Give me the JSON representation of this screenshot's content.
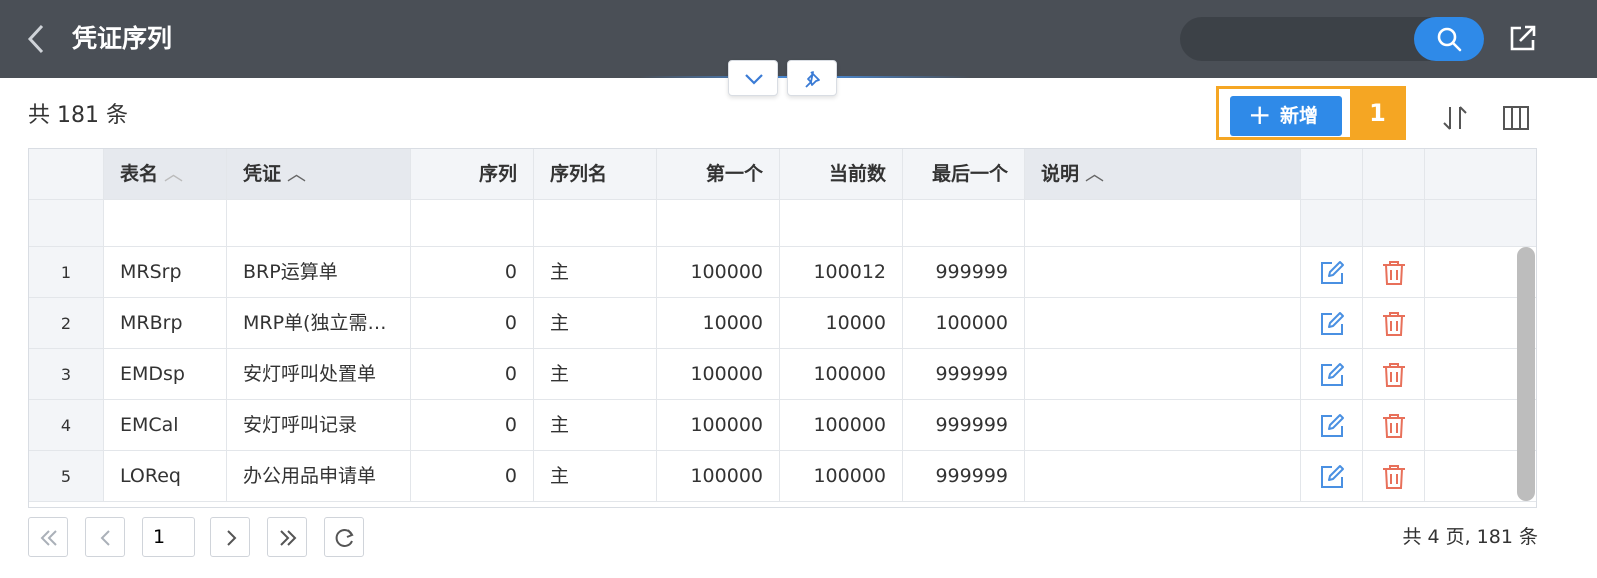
{
  "header": {
    "title": "凭证序列",
    "search_placeholder": ""
  },
  "toolbar": {
    "count_text": "共 181 条",
    "add_label": "新增",
    "badge": "1"
  },
  "table": {
    "columns": [
      "表名",
      "凭证",
      "序列",
      "序列名",
      "第一个",
      "当前数",
      "最后一个",
      "说明"
    ],
    "rows": [
      {
        "index": "1",
        "table_name": "MRSrp",
        "voucher": "BRP运算单",
        "seq": "0",
        "seq_name": "主",
        "first": "100000",
        "current": "100012",
        "last": "999999",
        "desc": ""
      },
      {
        "index": "2",
        "table_name": "MRBrp",
        "voucher": "MRP单(独立需…",
        "seq": "0",
        "seq_name": "主",
        "first": "10000",
        "current": "10000",
        "last": "100000",
        "desc": ""
      },
      {
        "index": "3",
        "table_name": "EMDsp",
        "voucher": "安灯呼叫处置单",
        "seq": "0",
        "seq_name": "主",
        "first": "100000",
        "current": "100000",
        "last": "999999",
        "desc": ""
      },
      {
        "index": "4",
        "table_name": "EMCal",
        "voucher": "安灯呼叫记录",
        "seq": "0",
        "seq_name": "主",
        "first": "100000",
        "current": "100000",
        "last": "999999",
        "desc": ""
      },
      {
        "index": "5",
        "table_name": "LOReq",
        "voucher": "办公用品申请单",
        "seq": "0",
        "seq_name": "主",
        "first": "100000",
        "current": "100000",
        "last": "999999",
        "desc": ""
      }
    ]
  },
  "pagination": {
    "current_page": "1",
    "summary": "共 4 页, 181 条"
  },
  "colors": {
    "topbar": "#4a4f56",
    "primary": "#2f8ae8",
    "highlight": "#f5a623",
    "edit_icon": "#4a90e2",
    "delete_icon": "#e8705a"
  },
  "icons": [
    "back-arrow-icon",
    "search-icon",
    "export-icon",
    "chevron-down-icon",
    "pin-icon",
    "plus-icon",
    "sort-icon",
    "columns-icon",
    "edit-icon",
    "trash-icon",
    "first-page-icon",
    "prev-page-icon",
    "next-page-icon",
    "last-page-icon",
    "refresh-icon"
  ]
}
